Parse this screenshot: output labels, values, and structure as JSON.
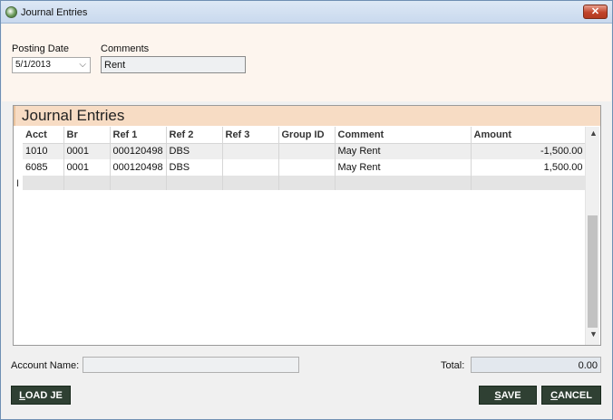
{
  "window": {
    "title": "Journal Entries"
  },
  "header": {
    "posting_date_label": "Posting Date",
    "posting_date_value": "5/1/2013",
    "comments_label": "Comments",
    "comments_value": "Rent"
  },
  "grid": {
    "title": "Journal Entries",
    "columns": [
      "Acct",
      "Br",
      "Ref 1",
      "Ref 2",
      "Ref 3",
      "Group ID",
      "Comment",
      "Amount"
    ],
    "rows": [
      {
        "acct": "1010",
        "br": "0001",
        "ref1": "000120498",
        "ref2": "DBS",
        "ref3": "",
        "group_id": "",
        "comment": "May Rent",
        "amount": "-1,500.00"
      },
      {
        "acct": "6085",
        "br": "0001",
        "ref1": "000120498",
        "ref2": "DBS",
        "ref3": "",
        "group_id": "",
        "comment": "May Rent",
        "amount": "1,500.00"
      }
    ]
  },
  "footer": {
    "account_name_label": "Account Name:",
    "account_name_value": "",
    "total_label": "Total:",
    "total_value": "0.00"
  },
  "buttons": {
    "load_je_u": "L",
    "load_je_rest": "OAD JE",
    "save_u": "S",
    "save_rest": "AVE",
    "cancel_u": "C",
    "cancel_rest": "ANCEL"
  },
  "icons": {
    "app": "app-globe-icon",
    "close": "close-icon",
    "dropdown": "chevron-down-icon",
    "cursor": "text-cursor-icon",
    "scroll_up": "scroll-up-arrow-icon",
    "scroll_down": "scroll-down-arrow-icon"
  }
}
